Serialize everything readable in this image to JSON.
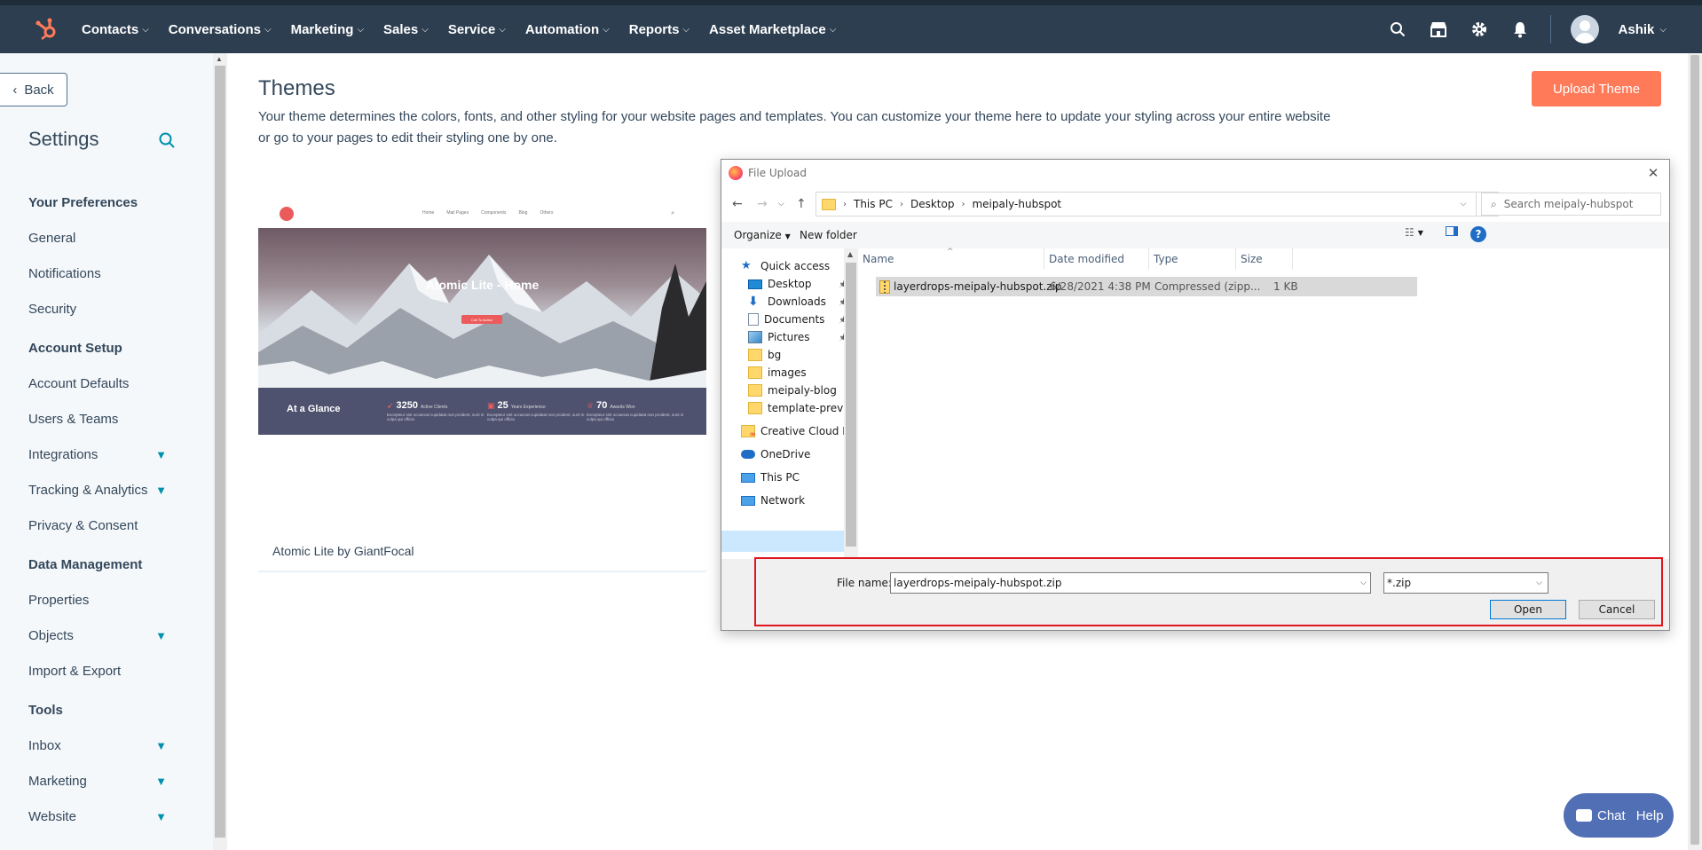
{
  "topnav": {
    "items": [
      "Contacts",
      "Conversations",
      "Marketing",
      "Sales",
      "Service",
      "Automation",
      "Reports",
      "Asset Marketplace"
    ],
    "user_name": "Ashik",
    "icons": [
      "search-icon",
      "marketplace-icon",
      "gear-icon",
      "bell-icon"
    ]
  },
  "sidebar": {
    "back_label": "Back",
    "title": "Settings",
    "sections": [
      {
        "heading": "Your Preferences",
        "items": [
          {
            "label": "General",
            "expandable": false
          },
          {
            "label": "Notifications",
            "expandable": false
          },
          {
            "label": "Security",
            "expandable": false
          }
        ]
      },
      {
        "heading": "Account Setup",
        "items": [
          {
            "label": "Account Defaults",
            "expandable": false
          },
          {
            "label": "Users & Teams",
            "expandable": false
          },
          {
            "label": "Integrations",
            "expandable": true
          },
          {
            "label": "Tracking & Analytics",
            "expandable": true
          },
          {
            "label": "Privacy & Consent",
            "expandable": false
          }
        ]
      },
      {
        "heading": "Data Management",
        "items": [
          {
            "label": "Properties",
            "expandable": false
          },
          {
            "label": "Objects",
            "expandable": true
          },
          {
            "label": "Import & Export",
            "expandable": false
          }
        ]
      },
      {
        "heading": "Tools",
        "items": [
          {
            "label": "Inbox",
            "expandable": true
          },
          {
            "label": "Marketing",
            "expandable": true
          },
          {
            "label": "Website",
            "expandable": true
          }
        ]
      }
    ]
  },
  "main": {
    "title": "Themes",
    "description": "Your theme determines the colors, fonts, and other styling for your website pages and templates. You can customize your theme here to update your styling across your entire website or go to your pages to edit their styling one by one.",
    "upload_button": "Upload Theme",
    "theme_card": {
      "name": "Atomic Lite by GiantFocal",
      "preview": {
        "nav_links": [
          "Home",
          "Mail Pages",
          "Components",
          "Blog",
          "Others"
        ],
        "hero_title": "Atomic Lite - Home",
        "hero_button": "Call To Action",
        "band_title": "At a Glance",
        "stats": [
          {
            "value": "3250",
            "label": "Active Clients",
            "text": "Excepteur sint occaecat cupidatat non proident, sunt in culpa qui officia"
          },
          {
            "value": "25",
            "label": "Years Experience",
            "text": "Excepteur sint occaecat cupidatat non proident, sunt in culpa qui officia"
          },
          {
            "value": "70",
            "label": "Awards Won",
            "text": "Excepteur sint occaecat cupidatat non proident, sunt in culpa qui officia"
          }
        ]
      }
    }
  },
  "dialog": {
    "title": "File Upload",
    "path": [
      "This PC",
      "Desktop",
      "meipaly-hubspot"
    ],
    "search_placeholder": "Search meipaly-hubspot",
    "toolbar": {
      "organize": "Organize",
      "new_folder": "New folder"
    },
    "nav": [
      {
        "label": "Quick access",
        "icon": "star-icon",
        "pinned": false,
        "indent": false
      },
      {
        "label": "Desktop",
        "icon": "desktop-icon",
        "pinned": true,
        "indent": true
      },
      {
        "label": "Downloads",
        "icon": "download-icon",
        "pinned": true,
        "indent": true
      },
      {
        "label": "Documents",
        "icon": "document-icon",
        "pinned": true,
        "indent": true
      },
      {
        "label": "Pictures",
        "icon": "pictures-icon",
        "pinned": true,
        "indent": true
      },
      {
        "label": "bg",
        "icon": "folder-icon",
        "pinned": false,
        "indent": true
      },
      {
        "label": "images",
        "icon": "folder-icon",
        "pinned": false,
        "indent": true
      },
      {
        "label": "meipaly-blog",
        "icon": "folder-icon",
        "pinned": false,
        "indent": true
      },
      {
        "label": "template-previe",
        "icon": "folder-icon",
        "pinned": false,
        "indent": true
      },
      {
        "label": "Creative Cloud Fil",
        "icon": "creative-cloud-icon",
        "pinned": false,
        "indent": false
      },
      {
        "label": "OneDrive",
        "icon": "cloud-icon",
        "pinned": false,
        "indent": false
      },
      {
        "label": "This PC",
        "icon": "computer-icon",
        "pinned": false,
        "indent": false,
        "selected": true
      },
      {
        "label": "Network",
        "icon": "network-icon",
        "pinned": false,
        "indent": false
      }
    ],
    "columns": [
      "Name",
      "Date modified",
      "Type",
      "Size"
    ],
    "files": [
      {
        "name": "layerdrops-meipaly-hubspot.zip",
        "date": "6/28/2021 4:38 PM",
        "type": "Compressed (zipp...",
        "size": "1 KB"
      }
    ],
    "file_name_label": "File name:",
    "file_name_value": "layerdrops-meipaly-hubspot.zip",
    "file_type": "*.zip",
    "open_button": "Open",
    "cancel_button": "Cancel"
  },
  "chat": {
    "chat_label": "Chat",
    "help_label": "Help"
  },
  "colors": {
    "nav_bg": "#2d3e50",
    "accent": "#ff7a59",
    "link": "#0091ae",
    "highlight": "#e0161f"
  }
}
